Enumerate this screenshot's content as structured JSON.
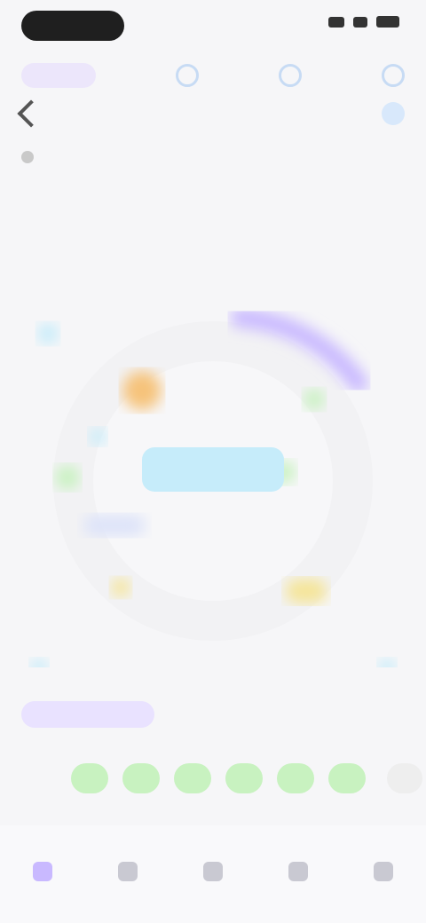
{
  "status": {
    "time": "",
    "signal": "signal-icon",
    "wifi": "wifi-icon",
    "battery": "battery-icon"
  },
  "header": {
    "nav_chip": "",
    "icons": [
      "compass-icon",
      "calendar-icon",
      "settings-icon"
    ],
    "title": "",
    "info": "",
    "hint": "",
    "section_heading": ""
  },
  "wheel": {
    "center_label": "",
    "labels": [
      "",
      "",
      "",
      "",
      "",
      "",
      "",
      "",
      "",
      ""
    ]
  },
  "tabs": {
    "active": "",
    "items": [
      "",
      ""
    ]
  },
  "days": {
    "items": [
      "",
      "",
      "",
      "",
      "",
      ""
    ]
  },
  "bottom_row": {
    "left": "",
    "right": ""
  },
  "bottom_nav": {
    "items": [
      {
        "name": "home",
        "icon": "home-icon",
        "label": ""
      },
      {
        "name": "explore",
        "icon": "explore-icon",
        "label": ""
      },
      {
        "name": "add",
        "icon": "add-icon",
        "label": ""
      },
      {
        "name": "stats",
        "icon": "stats-icon",
        "label": ""
      },
      {
        "name": "profile",
        "icon": "profile-icon",
        "label": ""
      }
    ]
  },
  "colors": {
    "purple": "#c9b9ff",
    "green": "#c8f2c0",
    "blue": "#c6ecfa",
    "yellow": "#f5e59a",
    "orange": "#f6c37a"
  }
}
